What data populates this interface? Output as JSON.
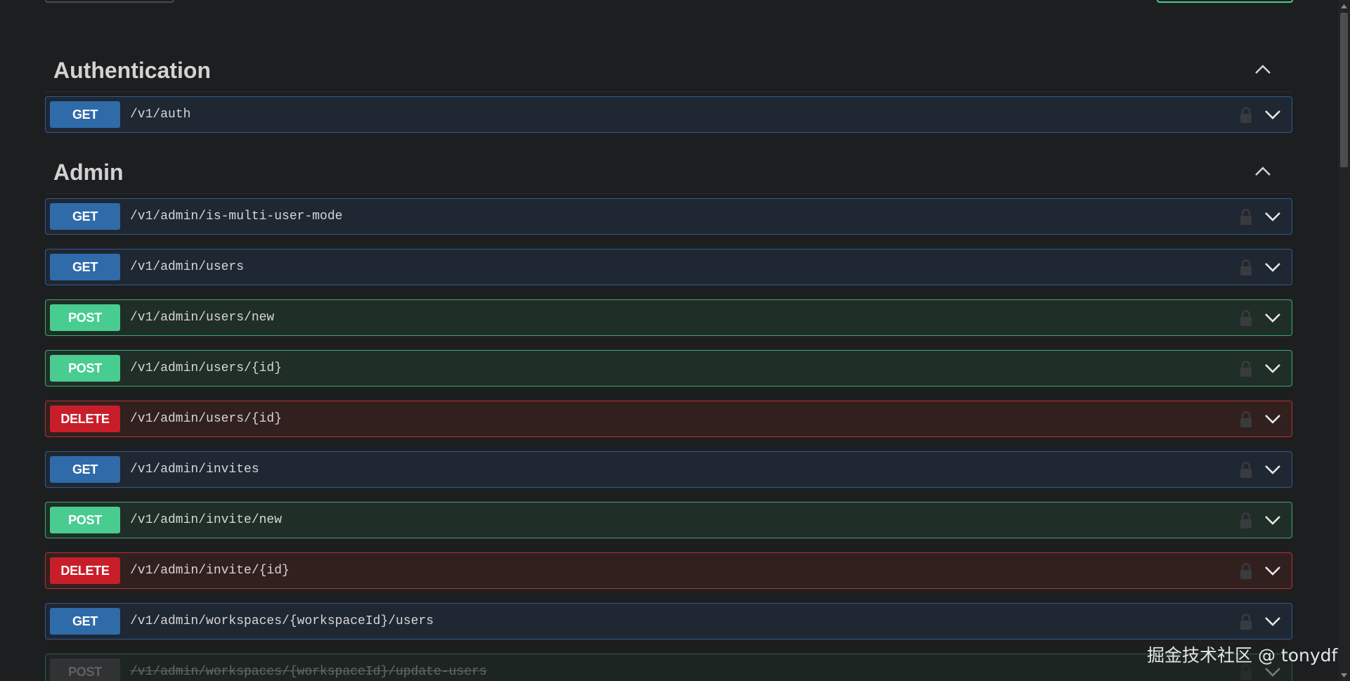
{
  "sections": [
    {
      "title": "Authentication",
      "operations": [
        {
          "method": "GET",
          "path": "/v1/auth"
        }
      ]
    },
    {
      "title": "Admin",
      "operations": [
        {
          "method": "GET",
          "path": "/v1/admin/is-multi-user-mode"
        },
        {
          "method": "GET",
          "path": "/v1/admin/users"
        },
        {
          "method": "POST",
          "path": "/v1/admin/users/new"
        },
        {
          "method": "POST",
          "path": "/v1/admin/users/{id}"
        },
        {
          "method": "DELETE",
          "path": "/v1/admin/users/{id}"
        },
        {
          "method": "GET",
          "path": "/v1/admin/invites"
        },
        {
          "method": "POST",
          "path": "/v1/admin/invite/new"
        },
        {
          "method": "DELETE",
          "path": "/v1/admin/invite/{id}"
        },
        {
          "method": "GET",
          "path": "/v1/admin/workspaces/{workspaceId}/users"
        },
        {
          "method": "POST",
          "path": "/v1/admin/workspaces/{workspaceId}/update-users",
          "faded": true
        }
      ]
    }
  ],
  "icons": {
    "collapse": "chevron-up-icon",
    "expand": "chevron-down-icon",
    "auth": "lock-icon"
  },
  "colors": {
    "get": "#2f6aa9",
    "post": "#49cc90",
    "delete": "#c81e2a",
    "background": "#1d1e20"
  },
  "watermark": "掘金技术社区 @ tonydf"
}
